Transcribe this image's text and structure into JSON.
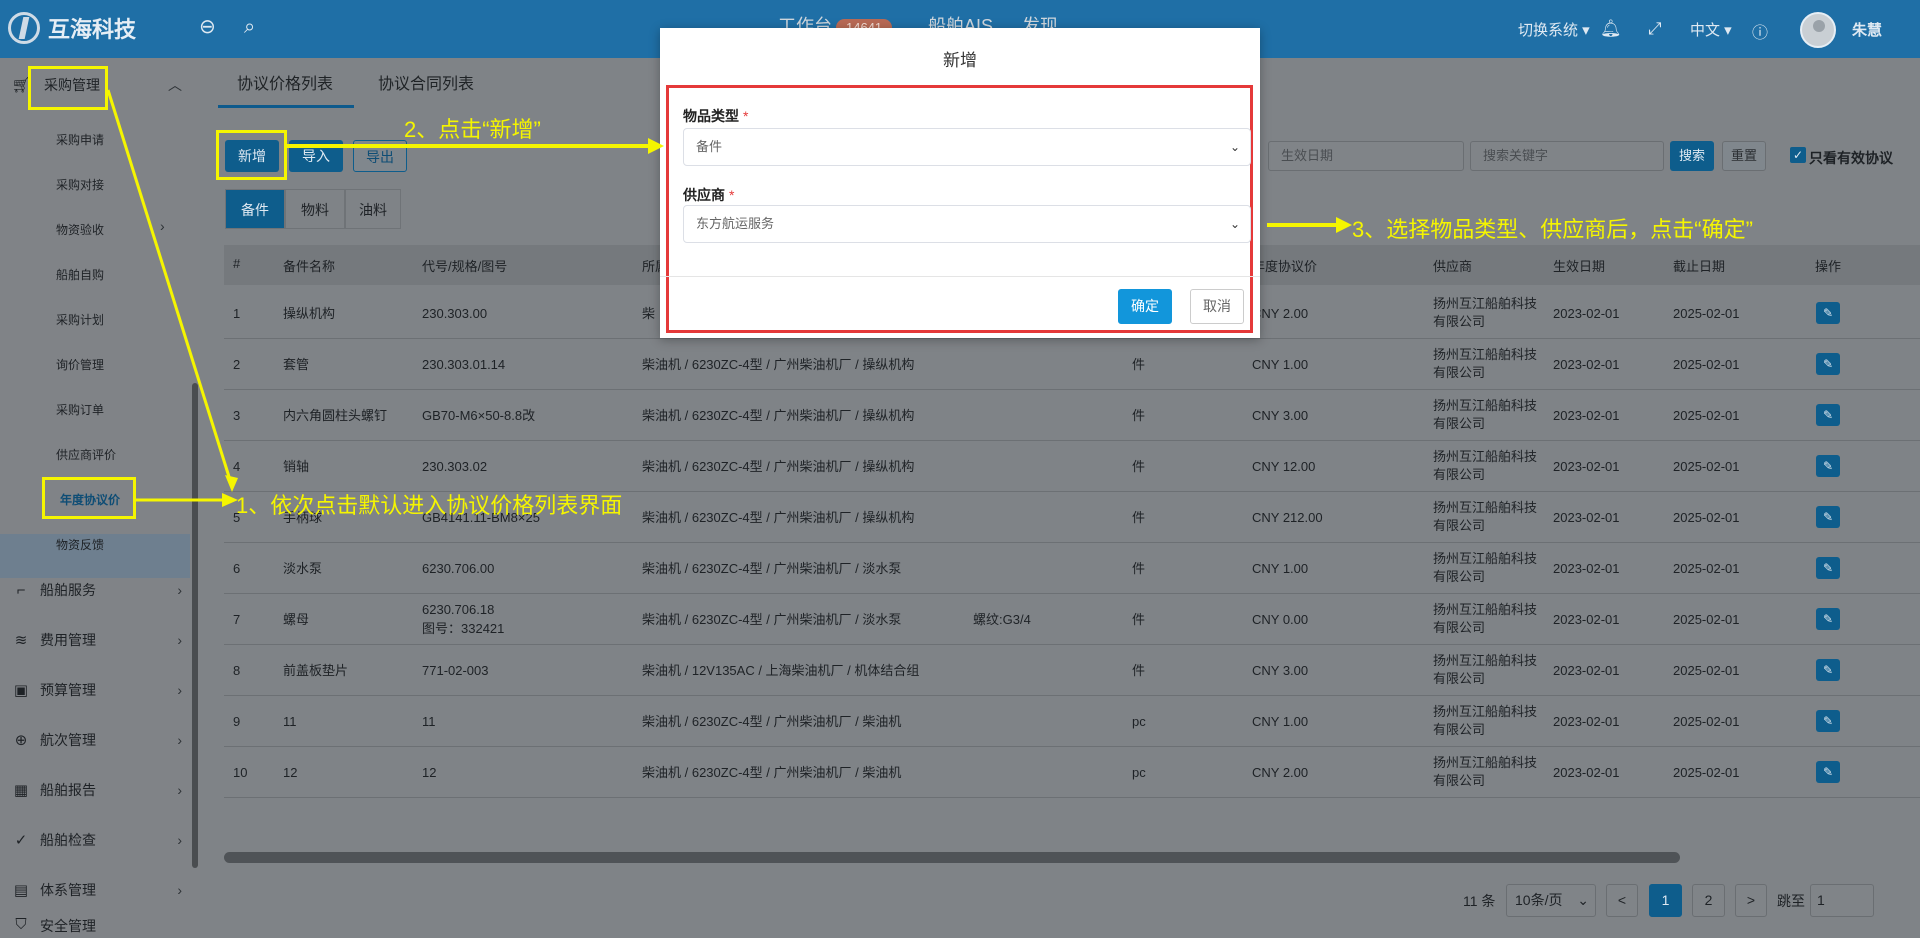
{
  "header": {
    "brand": "互海科技",
    "nav": [
      {
        "label": "工作台",
        "badge": "14641"
      },
      {
        "label": "船舶AIS"
      },
      {
        "label": "发现"
      }
    ],
    "switch_system": "切换系统",
    "language": "中文",
    "user_name": "朱慧"
  },
  "sidebar": {
    "section_purchase": "采购管理",
    "purchase_items": [
      "采购申请",
      "采购对接",
      "物资验收",
      "船舶自购",
      "采购计划",
      "询价管理",
      "采购订单",
      "供应商评价",
      "年度协议价",
      "物资反馈"
    ],
    "sections": [
      "船舶服务",
      "费用管理",
      "预算管理",
      "航次管理",
      "船舶报告",
      "船舶检查",
      "体系管理",
      "安全管理"
    ]
  },
  "tabs": [
    "协议价格列表",
    "协议合同列表"
  ],
  "toolbar": {
    "add": "新增",
    "import": "导入",
    "export": "导出",
    "date_placeholder": "生效日期",
    "keyword_placeholder": "搜索关键字",
    "search": "搜索",
    "reset": "重置",
    "only_valid": "只看有效协议"
  },
  "category_tabs": [
    "备件",
    "物料",
    "油料"
  ],
  "table": {
    "headers": [
      "#",
      "备件名称",
      "代号/规格/图号",
      "所属设备",
      "",
      "",
      "年度协议价",
      "供应商",
      "生效日期",
      "截止日期",
      "操作"
    ],
    "rows": [
      {
        "no": "1",
        "name": "操纵机构",
        "code": "230.303.00",
        "code2": "",
        "equip": "柴",
        "spec": "",
        "unit": "",
        "price": "CNY  2.00",
        "supplier": "扬州互江船舶科技有限公司",
        "start": "2023-02-01",
        "end": "2025-02-01"
      },
      {
        "no": "2",
        "name": "套管",
        "code": "230.303.01.14",
        "code2": "",
        "equip": "柴油机 / 6230ZC-4型 / 广州柴油机厂 / 操纵机构",
        "spec": "",
        "unit": "件",
        "price": "CNY  1.00",
        "supplier": "扬州互江船舶科技有限公司",
        "start": "2023-02-01",
        "end": "2025-02-01"
      },
      {
        "no": "3",
        "name": "内六角圆柱头螺钉",
        "code": "GB70-M6×50-8.8改",
        "code2": "",
        "equip": "柴油机 / 6230ZC-4型 / 广州柴油机厂 / 操纵机构",
        "spec": "",
        "unit": "件",
        "price": "CNY  3.00",
        "supplier": "扬州互江船舶科技有限公司",
        "start": "2023-02-01",
        "end": "2025-02-01"
      },
      {
        "no": "4",
        "name": "销轴",
        "code": "230.303.02",
        "code2": "",
        "equip": "柴油机 / 6230ZC-4型 / 广州柴油机厂 / 操纵机构",
        "spec": "",
        "unit": "件",
        "price": "CNY  12.00",
        "supplier": "扬州互江船舶科技有限公司",
        "start": "2023-02-01",
        "end": "2025-02-01"
      },
      {
        "no": "5",
        "name": "手柄球",
        "code": "GB4141.11-BM8×25",
        "code2": "",
        "equip": "柴油机 / 6230ZC-4型 / 广州柴油机厂 / 操纵机构",
        "spec": "",
        "unit": "件",
        "price": "CNY  212.00",
        "supplier": "扬州互江船舶科技有限公司",
        "start": "2023-02-01",
        "end": "2025-02-01"
      },
      {
        "no": "6",
        "name": "淡水泵",
        "code": "6230.706.00",
        "code2": "",
        "equip": "柴油机 / 6230ZC-4型 / 广州柴油机厂 / 淡水泵",
        "spec": "",
        "unit": "件",
        "price": "CNY  1.00",
        "supplier": "扬州互江船舶科技有限公司",
        "start": "2023-02-01",
        "end": "2025-02-01"
      },
      {
        "no": "7",
        "name": "螺母",
        "code": "6230.706.18",
        "code2": "图号：332421",
        "equip": "柴油机 / 6230ZC-4型 / 广州柴油机厂 / 淡水泵",
        "spec": "螺纹:G3/4",
        "unit": "件",
        "price": "CNY  0.00",
        "supplier": "扬州互江船舶科技有限公司",
        "start": "2023-02-01",
        "end": "2025-02-01"
      },
      {
        "no": "8",
        "name": "前盖板垫片",
        "code": "771-02-003",
        "code2": "",
        "equip": "柴油机 / 12V135AC / 上海柴油机厂 / 机体结合组",
        "spec": "",
        "unit": "件",
        "price": "CNY  3.00",
        "supplier": "扬州互江船舶科技有限公司",
        "start": "2023-02-01",
        "end": "2025-02-01"
      },
      {
        "no": "9",
        "name": "11",
        "code": "11",
        "code2": "",
        "equip": "柴油机 / 6230ZC-4型 / 广州柴油机厂 / 柴油机",
        "spec": "",
        "unit": "pc",
        "price": "CNY  1.00",
        "supplier": "扬州互江船舶科技有限公司",
        "start": "2023-02-01",
        "end": "2025-02-01"
      },
      {
        "no": "10",
        "name": "12",
        "code": "12",
        "code2": "",
        "equip": "柴油机 / 6230ZC-4型 / 广州柴油机厂 / 柴油机",
        "spec": "",
        "unit": "pc",
        "price": "CNY  2.00",
        "supplier": "扬州互江船舶科技有限公司",
        "start": "2023-02-01",
        "end": "2025-02-01"
      }
    ]
  },
  "pagination": {
    "total": "11 条",
    "page_size": "10条/页",
    "pages": [
      "1",
      "2"
    ],
    "goto_label": "跳至",
    "goto_value": "1",
    "prev": "<",
    "next": ">"
  },
  "modal": {
    "title": "新增",
    "field1_label": "物品类型",
    "field1_value": "备件",
    "field2_label": "供应商",
    "field2_value": "东方航运服务",
    "required_mark": "*",
    "ok": "确定",
    "cancel": "取消"
  },
  "annotations": {
    "step1": "1、依次点击默认进入协议价格列表界面",
    "step2": "2、点击“新增”",
    "step3": "3、选择物品类型、供应商后，点击“确定”"
  },
  "colors": {
    "header": "#1f6fa6",
    "primary": "#0e5d8c",
    "annotation": "#f5f500",
    "highlight_box": "#e53939",
    "ok_button": "#1296db"
  }
}
